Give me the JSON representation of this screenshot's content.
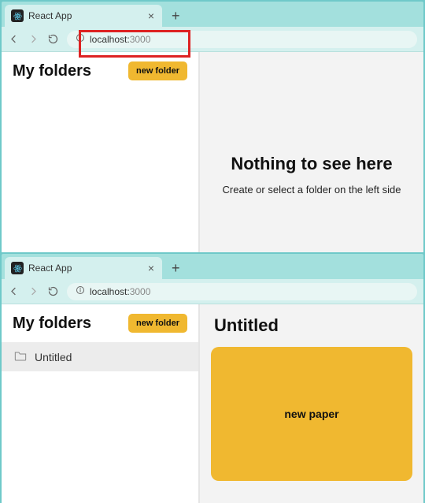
{
  "browser": {
    "tab_title": "React App",
    "url_host": "localhost:",
    "url_port": "3000"
  },
  "sidebar": {
    "title": "My folders",
    "new_folder_btn": "new folder",
    "folders": [
      {
        "name": "Untitled"
      }
    ]
  },
  "empty_state": {
    "title": "Nothing to see here",
    "subtitle": "Create or select a folder on the left side"
  },
  "folder_view": {
    "title": "Untitled",
    "new_paper_btn": "new paper"
  }
}
